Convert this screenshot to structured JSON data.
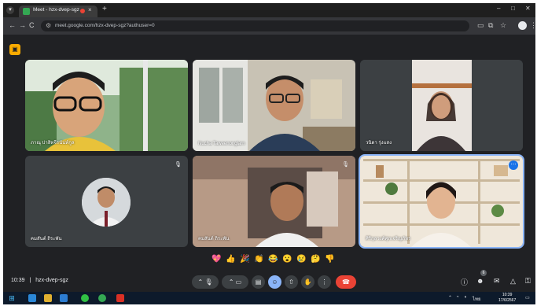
{
  "browser": {
    "tab_title": "Meet - hzx-dvep-sgz",
    "tab_close": "×",
    "new_tab": "+",
    "window_controls": [
      "–",
      "□",
      "✕"
    ],
    "menu": "▾",
    "url": "meet.google.com/hzx-dvep-sgz?authuser=0",
    "nav": {
      "back": "←",
      "forward": "→",
      "reload": "C"
    }
  },
  "meet": {
    "badge_icon": "activities-icon",
    "participants": [
      {
        "name": "ภาณุ ปาลิทจีรนันท์กูล"
      },
      {
        "name": "Nucha Taweenonglarn"
      },
      {
        "name": "วนิดา รุ่งแสง"
      },
      {
        "name": "คมสันต์ ถิระพัน"
      },
      {
        "name": "คมสันต์ ถิระพัน"
      },
      {
        "name": "ศิริกุลวงศ์ศุภเจริญภัทร"
      }
    ],
    "reactions": [
      "💖",
      "👍",
      "🎉",
      "👏",
      "😂",
      "😮",
      "😢",
      "🤔",
      "👎"
    ]
  },
  "controls": {
    "meeting_time": "10:39",
    "separator": "|",
    "meeting_code": "hzx-dvep-sgz",
    "people_count": "6"
  },
  "taskbar": {
    "time": "10:39",
    "date": "17/6/2567",
    "lang": "ไทย"
  },
  "colors": {
    "meet_bg": "#202124",
    "end_call": "#ea4335",
    "active_outline": "#8ab4f8",
    "accent_blue": "#1a73e8"
  }
}
